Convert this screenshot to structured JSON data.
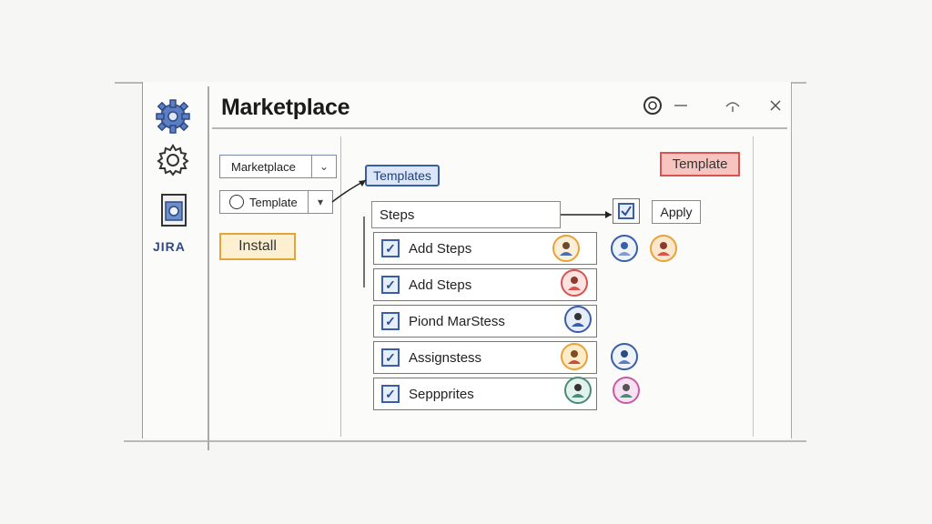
{
  "window": {
    "title": "Marketplace"
  },
  "sidebar": {
    "items": [
      {
        "icon": "gear-blue-icon"
      },
      {
        "icon": "gear-icon"
      },
      {
        "icon": "document-icon"
      },
      {
        "label": "JIRA"
      }
    ]
  },
  "left_panel": {
    "dropdown1_value": "Marketplace",
    "dropdown2_value": "Template",
    "install_label": "Install"
  },
  "main": {
    "template_tag": "Templates",
    "template_button": "Template",
    "steps_header": "Steps",
    "apply_label": "Apply",
    "steps": [
      {
        "label": "Add Steps",
        "checked": true
      },
      {
        "label": "Add Steps",
        "checked": true
      },
      {
        "label": "Piond MarStess",
        "checked": true
      },
      {
        "label": "Assignstess",
        "checked": true
      },
      {
        "label": "Seppprites",
        "checked": true
      }
    ]
  },
  "colors": {
    "accent_blue": "#3a5da8",
    "install_orange": "#e3a43a",
    "template_red": "#d9534f"
  }
}
